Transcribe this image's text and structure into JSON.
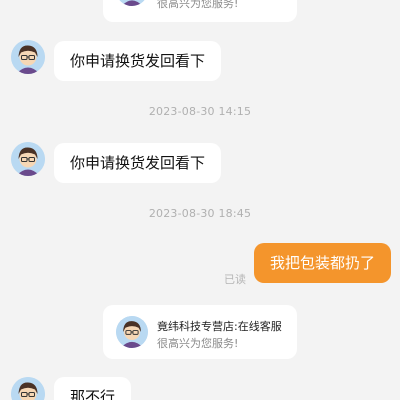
{
  "top_card": {
    "subtitle": "很高兴为您服务!"
  },
  "messages": [
    {
      "text": "你申请换货发回看下"
    },
    {
      "time": "2023-08-30 14:15"
    },
    {
      "text": "你申请换货发回看下"
    },
    {
      "time": "2023-08-30 18:45"
    },
    {
      "text": "我把包装都扔了",
      "read": "已读"
    },
    {
      "card_title": "竟纬科技专营店:在线客服",
      "card_subtitle": "很高兴为您服务!"
    },
    {
      "text": "那不行"
    }
  ],
  "colors": {
    "background": "#f3f3f3",
    "my_bubble": "#f4952c",
    "other_bubble": "#ffffff",
    "timestamp": "#b0b0b0"
  },
  "icons": {
    "agent_avatar": "agent-avatar-icon"
  }
}
